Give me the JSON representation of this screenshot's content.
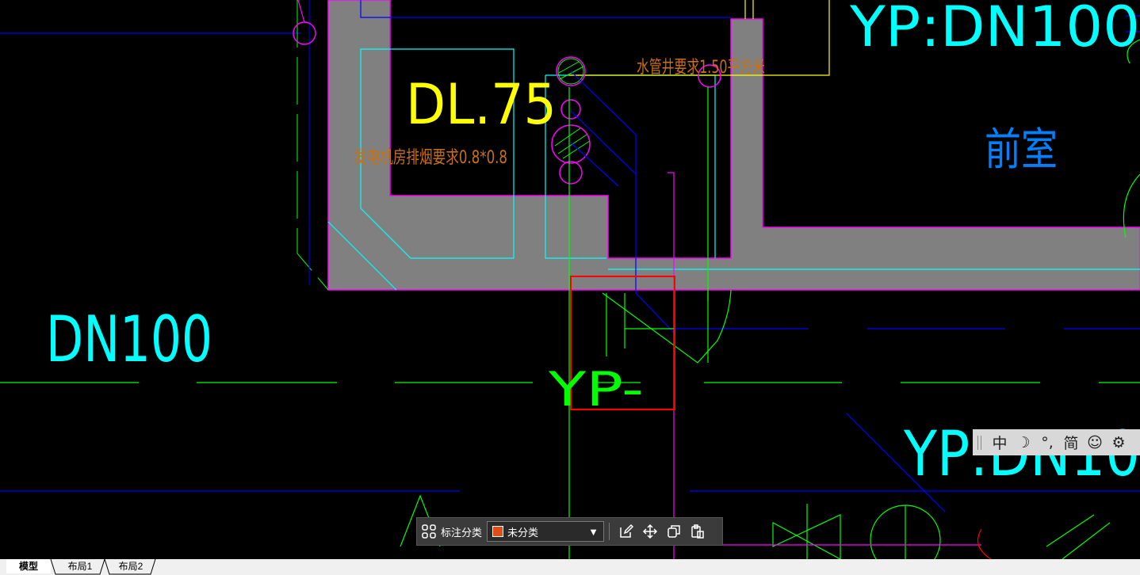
{
  "drawing": {
    "texts": {
      "dl75": "DL.75",
      "smoke_note": "发电机房排烟要求0.8*0.8",
      "pipe_shaft_note": "水管井要求1.50平方米",
      "front_room": "前室",
      "dn100": "DN100",
      "yp_dn_top": "YP:DN100",
      "yp_mid": "YP-",
      "yp_dn_right": "YP:DN10"
    },
    "colors": {
      "wall_fill": "#808080",
      "wall_edge": "#ff00ff",
      "cyan": "#00ffff",
      "yellow": "#ffff00",
      "green": "#00ff00",
      "blue": "#0000ff",
      "orange_text": "#c87014",
      "selection_box": "#ff0000"
    }
  },
  "ime_toolbar": {
    "items": [
      {
        "label": "中",
        "icon": "chinese-mode-icon"
      },
      {
        "label": "☽",
        "icon": "half-width-moon-icon"
      },
      {
        "label": "°,",
        "icon": "punctuation-icon"
      },
      {
        "label": "简",
        "icon": "simplified-icon"
      },
      {
        "label": "☺",
        "icon": "emoji-icon"
      },
      {
        "label": "⚙",
        "icon": "gear-icon"
      }
    ]
  },
  "annotation_toolbar": {
    "label": "标注分类",
    "selected": "未分类",
    "swatch_color": "#e04e14"
  },
  "layout_tabs": [
    {
      "label": "模型",
      "active": true
    },
    {
      "label": "布局1",
      "active": false
    },
    {
      "label": "布局2",
      "active": false
    }
  ]
}
